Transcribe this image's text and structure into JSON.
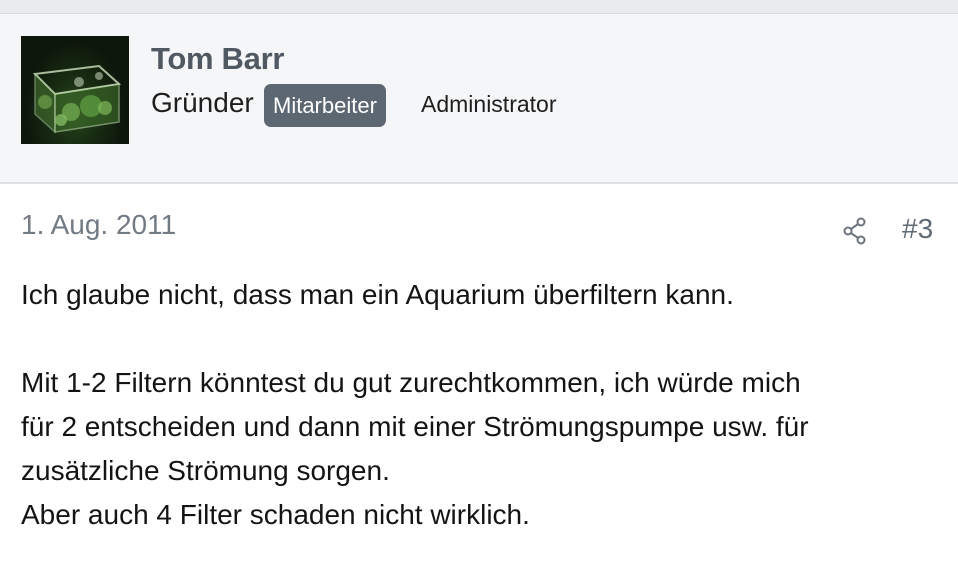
{
  "author": {
    "name": "Tom Barr",
    "title": "Gründer",
    "badge": "Mitarbeiter",
    "role": "Administrator",
    "avatar_icon": "aquarium-avatar"
  },
  "post": {
    "date": "1. Aug. 2011",
    "number": "#3",
    "share_icon": "share-icon",
    "paragraphs": [
      "Ich glaube nicht, dass man ein Aquarium überfiltern kann.",
      "Mit 1-2 Filtern könntest du gut zurechtkommen, ich würde mich",
      "für 2 entscheiden und dann mit einer Strömungspumpe usw. für",
      "zusätzliche Strömung sorgen.",
      "Aber auch 4 Filter schaden nicht wirklich."
    ]
  },
  "colors": {
    "header_background": "#f5f6f7",
    "badge_background": "#5d6771",
    "username": "#505862",
    "meta_text": "#727a83"
  }
}
